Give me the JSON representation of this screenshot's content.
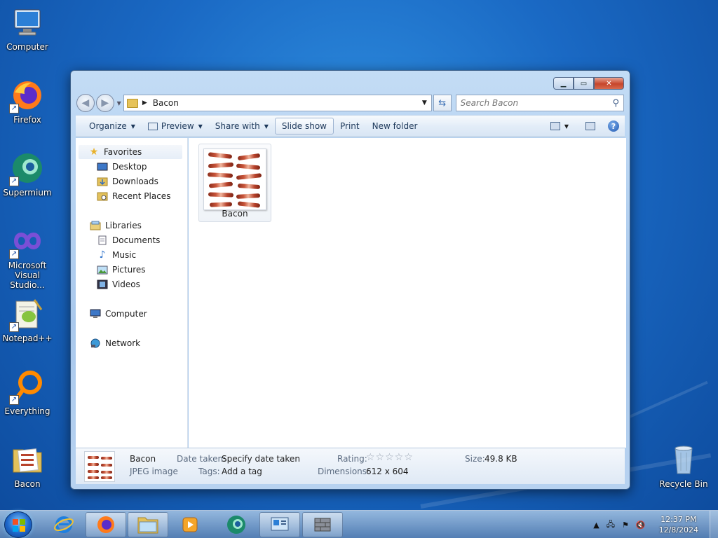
{
  "desktop": {
    "icons": [
      {
        "label": "Computer"
      },
      {
        "label": "Firefox"
      },
      {
        "label": "Supermium"
      },
      {
        "label": "Microsoft Visual Studio..."
      },
      {
        "label": "Notepad++"
      },
      {
        "label": "Everything"
      },
      {
        "label": "Bacon"
      },
      {
        "label": "Recycle Bin"
      }
    ]
  },
  "explorer": {
    "address": {
      "current_folder": "Bacon"
    },
    "search": {
      "placeholder": "Search Bacon"
    },
    "toolbar": {
      "organize": "Organize",
      "preview": "Preview",
      "share_with": "Share with",
      "slide_show": "Slide show",
      "print": "Print",
      "new_folder": "New folder"
    },
    "nav": {
      "favorites": "Favorites",
      "desktop": "Desktop",
      "downloads": "Downloads",
      "recent_places": "Recent Places",
      "libraries": "Libraries",
      "documents": "Documents",
      "music": "Music",
      "pictures": "Pictures",
      "videos": "Videos",
      "computer": "Computer",
      "network": "Network"
    },
    "files": [
      {
        "name": "Bacon"
      }
    ],
    "details": {
      "name": "Bacon",
      "type": "JPEG image",
      "date_taken_label": "Date taken:",
      "date_taken_value": "Specify date taken",
      "tags_label": "Tags:",
      "tags_value": "Add a tag",
      "rating_label": "Rating:",
      "rating_value": "☆☆☆☆☆",
      "dimensions_label": "Dimensions:",
      "dimensions_value": "612 x 604",
      "size_label": "Size:",
      "size_value": "49.8 KB"
    }
  },
  "taskbar": {
    "clock_time": "12:37 PM",
    "clock_date": "12/8/2024"
  },
  "colors": {
    "desktop_bg": "#1a69c4",
    "window_frame": "#a9c8ec",
    "close_button": "#c7452b"
  }
}
